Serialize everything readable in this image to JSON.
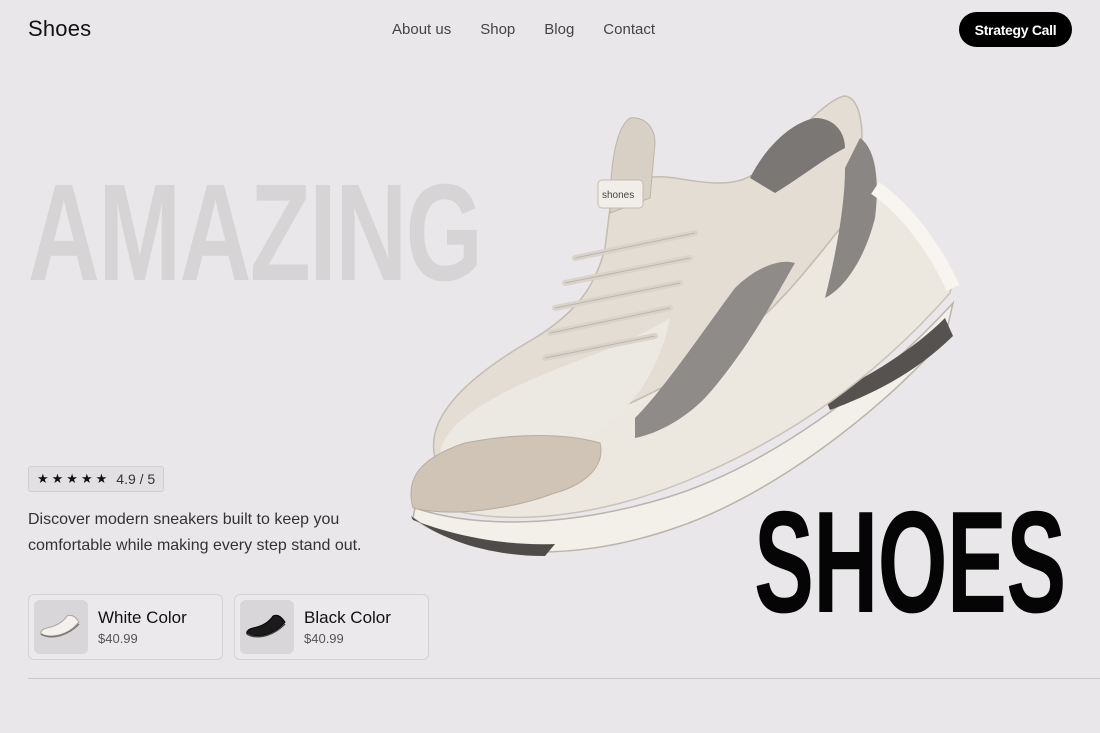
{
  "header": {
    "brand": "Shoes",
    "nav": [
      "About us",
      "Shop",
      "Blog",
      "Contact"
    ],
    "cta_label": "Strategy Call"
  },
  "hero": {
    "headline_top": "AMAZING",
    "headline_bottom": "SHOES",
    "shoe_logo_text": "shones",
    "rating": {
      "stars": 5,
      "text": "4.9 / 5"
    },
    "description": "Discover modern sneakers built to keep you comfortable while making every step stand out."
  },
  "variants": [
    {
      "name": "White Color",
      "price": "$40.99",
      "swatch": "#f2efe9"
    },
    {
      "name": "Black Color",
      "price": "$40.99",
      "swatch": "#1b1b1b"
    }
  ],
  "colors": {
    "background": "#e9e7ea",
    "accent": "#000000",
    "headline_light": "#d6d4d5"
  }
}
